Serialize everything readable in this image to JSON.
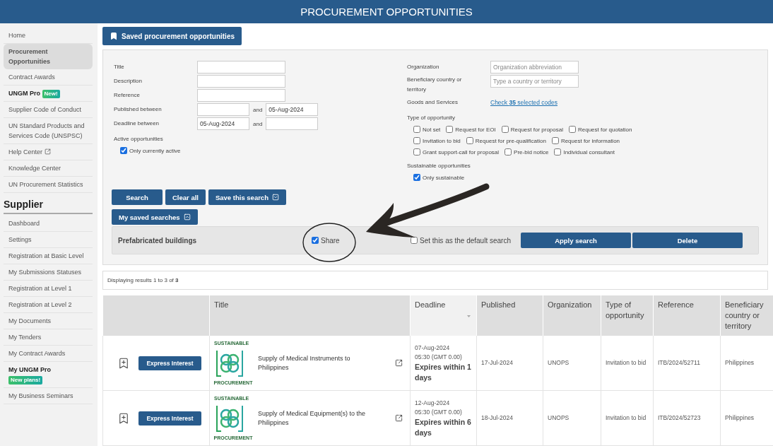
{
  "header": {
    "title": "PROCUREMENT OPPORTUNITIES"
  },
  "sidebar": {
    "items": [
      {
        "label": "Home",
        "kind": "link",
        "selected": false
      },
      {
        "label": "Procurement Opportunities",
        "kind": "link",
        "selected": true
      },
      {
        "label": "Contract Awards",
        "kind": "link",
        "selected": false
      },
      {
        "label": "UNGM Pro",
        "kind": "pro",
        "badge": "New!",
        "selected": false
      },
      {
        "label": "Supplier Code of Conduct",
        "kind": "link",
        "selected": false
      },
      {
        "label": "UN Standard Products and Services Code (UNSPSC)",
        "kind": "link",
        "selected": false
      },
      {
        "label": "Help Center",
        "kind": "external",
        "selected": false
      },
      {
        "label": "Knowledge Center",
        "kind": "link",
        "selected": false
      },
      {
        "label": "UN Procurement Statistics",
        "kind": "link",
        "selected": false
      }
    ],
    "section": "Supplier",
    "section_items": [
      {
        "label": "Dashboard",
        "kind": "link",
        "selected": false
      },
      {
        "label": "Settings",
        "kind": "link",
        "selected": false
      },
      {
        "label": "Registration at Basic Level",
        "kind": "link",
        "selected": false
      },
      {
        "label": "My Submissions Statuses",
        "kind": "link",
        "selected": false
      },
      {
        "label": "Registration at Level 1",
        "kind": "link",
        "selected": false
      },
      {
        "label": "Registration at Level 2",
        "kind": "link",
        "selected": false
      },
      {
        "label": "My Documents",
        "kind": "link",
        "selected": false
      },
      {
        "label": "My Tenders",
        "kind": "link",
        "selected": false
      },
      {
        "label": "My Contract Awards",
        "kind": "link",
        "selected": false
      },
      {
        "label": "My UNGM Pro",
        "kind": "pro-stacked",
        "badge": "New plans!",
        "selected": false
      },
      {
        "label": "My Business Seminars",
        "kind": "link",
        "selected": false
      }
    ]
  },
  "saved_button": {
    "label": "Saved procurement opportunities"
  },
  "filters": {
    "text_fields": [
      {
        "label": "Title"
      },
      {
        "label": "Description"
      },
      {
        "label": "Reference"
      }
    ],
    "ranges": [
      {
        "label": "Published between",
        "and": "and",
        "to": "05-Aug-2024"
      },
      {
        "label": "Deadline between",
        "from": "05-Aug-2024",
        "and": "and"
      }
    ],
    "active": {
      "label": "Active opportunities",
      "options": [
        {
          "label": "Only currently active",
          "checked": true
        }
      ]
    },
    "organization": {
      "label": "Organization",
      "placeholder": "Organization abbreviation"
    },
    "beneficiary": {
      "label": "Beneficiary country or territory",
      "placeholder": "Type a country or territory"
    },
    "goods": {
      "label": "Goods and Services",
      "link": "Check **35** selected codes"
    },
    "type_of_opportunity": {
      "label": "Type of opportunity",
      "options": [
        {
          "label": "Not set",
          "checked": false
        },
        {
          "label": "Request for EOI",
          "checked": false
        },
        {
          "label": "Request for proposal",
          "checked": false
        },
        {
          "label": "Request for quotation",
          "checked": false
        },
        {
          "label": "Invitation to bid",
          "checked": false
        },
        {
          "label": "Request for pre-qualification",
          "checked": false
        },
        {
          "label": "Request for information",
          "checked": false
        },
        {
          "label": "Grant support-call for proposal",
          "checked": false
        },
        {
          "label": "Pre-bid notice",
          "checked": false
        },
        {
          "label": "Individual consultant",
          "checked": false
        }
      ]
    },
    "sustainable": {
      "label": "Sustainable opportunities",
      "options": [
        {
          "label": "Only sustainable",
          "checked": true
        }
      ]
    },
    "buttons": [
      {
        "label": "Search",
        "kind": "plain"
      },
      {
        "label": "Clear all",
        "kind": "plain"
      },
      {
        "label": "Save this search",
        "kind": "expand"
      }
    ],
    "saved_searches_button": {
      "label": "My saved searches",
      "kind": "collapse"
    },
    "saved_search": {
      "name": "Prefabricated buildings",
      "share": {
        "label": "Share",
        "checked": true
      },
      "default": {
        "label": "Set this as the default search",
        "checked": false
      },
      "buttons": [
        "Apply search",
        "Delete"
      ]
    }
  },
  "results": {
    "text": "Displaying results 1 to 3 of **3**"
  },
  "table": {
    "columns": [
      {
        "label": "Title",
        "sorted": false
      },
      {
        "label": "Deadline",
        "sorted": true
      },
      {
        "label": "Published",
        "sorted": false
      },
      {
        "label": "Organization",
        "sorted": false
      },
      {
        "label": "Type of opportunity",
        "sorted": false
      },
      {
        "label": "Reference",
        "sorted": false
      },
      {
        "label": "Beneficiary country or territory",
        "sorted": false
      }
    ],
    "rows": [
      {
        "action": "Express Interest",
        "logo_top": "SUSTAINABLE",
        "logo_bottom": "PROCUREMENT",
        "title": "Supply of Medical Instruments to Philippines",
        "deadline_date": "07-Aug-2024",
        "deadline_time": "05:30 (GMT 0.00)",
        "expires": "Expires within 1 days",
        "published": "17-Jul-2024",
        "organization": "UNOPS",
        "type": "Invitation to bid",
        "reference": "ITB/2024/52711",
        "country": "Philippines"
      },
      {
        "action": "Express Interest",
        "logo_top": "SUSTAINABLE",
        "logo_bottom": "PROCUREMENT",
        "title": "Supply of Medical Equipment(s) to the Philippines",
        "deadline_date": "12-Aug-2024",
        "deadline_time": "05:30 (GMT 0.00)",
        "expires": "Expires within 6 days",
        "published": "18-Jul-2024",
        "organization": "UNOPS",
        "type": "Invitation to bid",
        "reference": "ITB/2024/52723",
        "country": "Philippines"
      }
    ]
  }
}
